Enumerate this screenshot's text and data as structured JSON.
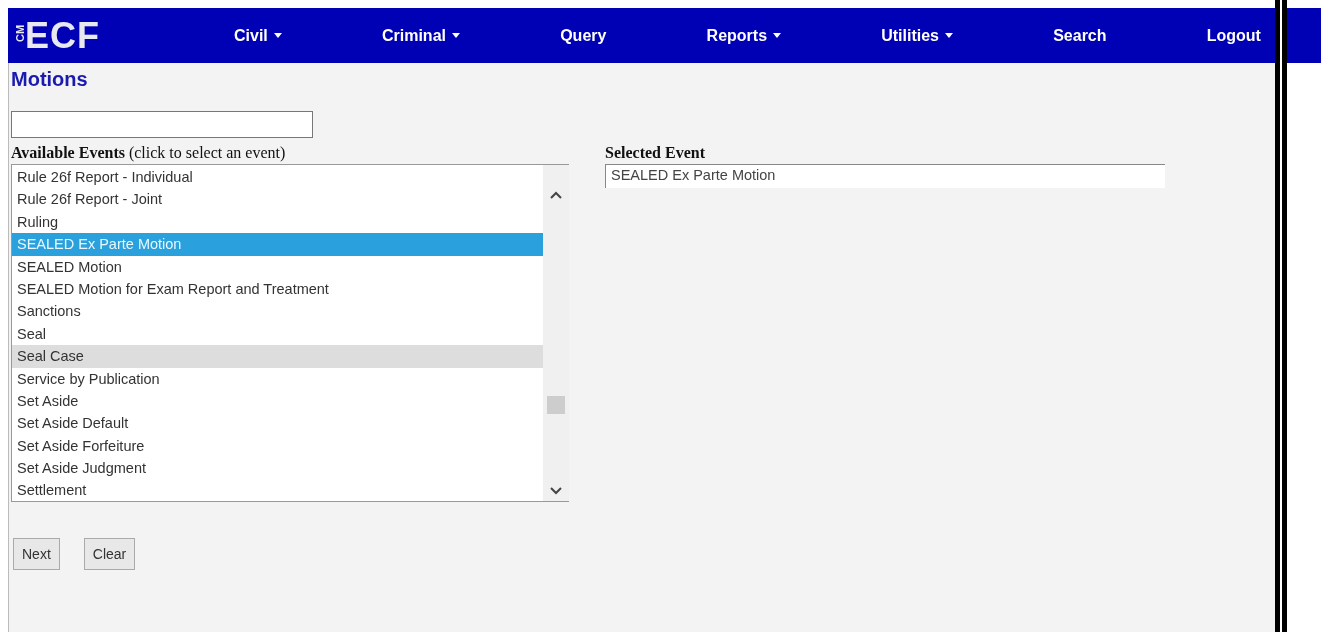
{
  "logo": {
    "small": "CM",
    "large": "ECF"
  },
  "nav": [
    {
      "label": "Civil",
      "has_menu": true
    },
    {
      "label": "Criminal",
      "has_menu": true
    },
    {
      "label": "Query",
      "has_menu": false
    },
    {
      "label": "Reports",
      "has_menu": true
    },
    {
      "label": "Utilities",
      "has_menu": true
    },
    {
      "label": "Search",
      "has_menu": false
    },
    {
      "label": "Logout",
      "has_menu": false
    }
  ],
  "page_title": "Motions",
  "available_label": "**Available Events** (click to select an event)",
  "events": [
    {
      "label": "Rule 26f Report - Individual",
      "selected": false,
      "hovered": false
    },
    {
      "label": "Rule 26f Report - Joint",
      "selected": false,
      "hovered": false
    },
    {
      "label": "Ruling",
      "selected": false,
      "hovered": false
    },
    {
      "label": "SEALED Ex Parte Motion",
      "selected": true,
      "hovered": false
    },
    {
      "label": "SEALED Motion",
      "selected": false,
      "hovered": false
    },
    {
      "label": "SEALED Motion for Exam Report and Treatment",
      "selected": false,
      "hovered": false
    },
    {
      "label": "Sanctions",
      "selected": false,
      "hovered": false
    },
    {
      "label": "Seal",
      "selected": false,
      "hovered": false
    },
    {
      "label": "Seal Case",
      "selected": false,
      "hovered": true
    },
    {
      "label": "Service by Publication",
      "selected": false,
      "hovered": false
    },
    {
      "label": "Set Aside",
      "selected": false,
      "hovered": false
    },
    {
      "label": "Set Aside Default",
      "selected": false,
      "hovered": false
    },
    {
      "label": "Set Aside Forfeiture",
      "selected": false,
      "hovered": false
    },
    {
      "label": "Set Aside Judgment",
      "selected": false,
      "hovered": false
    },
    {
      "label": "Settlement",
      "selected": false,
      "hovered": false
    }
  ],
  "selected_label": "Selected Event",
  "selected_event": "SEALED Ex Parte Motion",
  "buttons": [
    "Next",
    "Clear"
  ]
}
